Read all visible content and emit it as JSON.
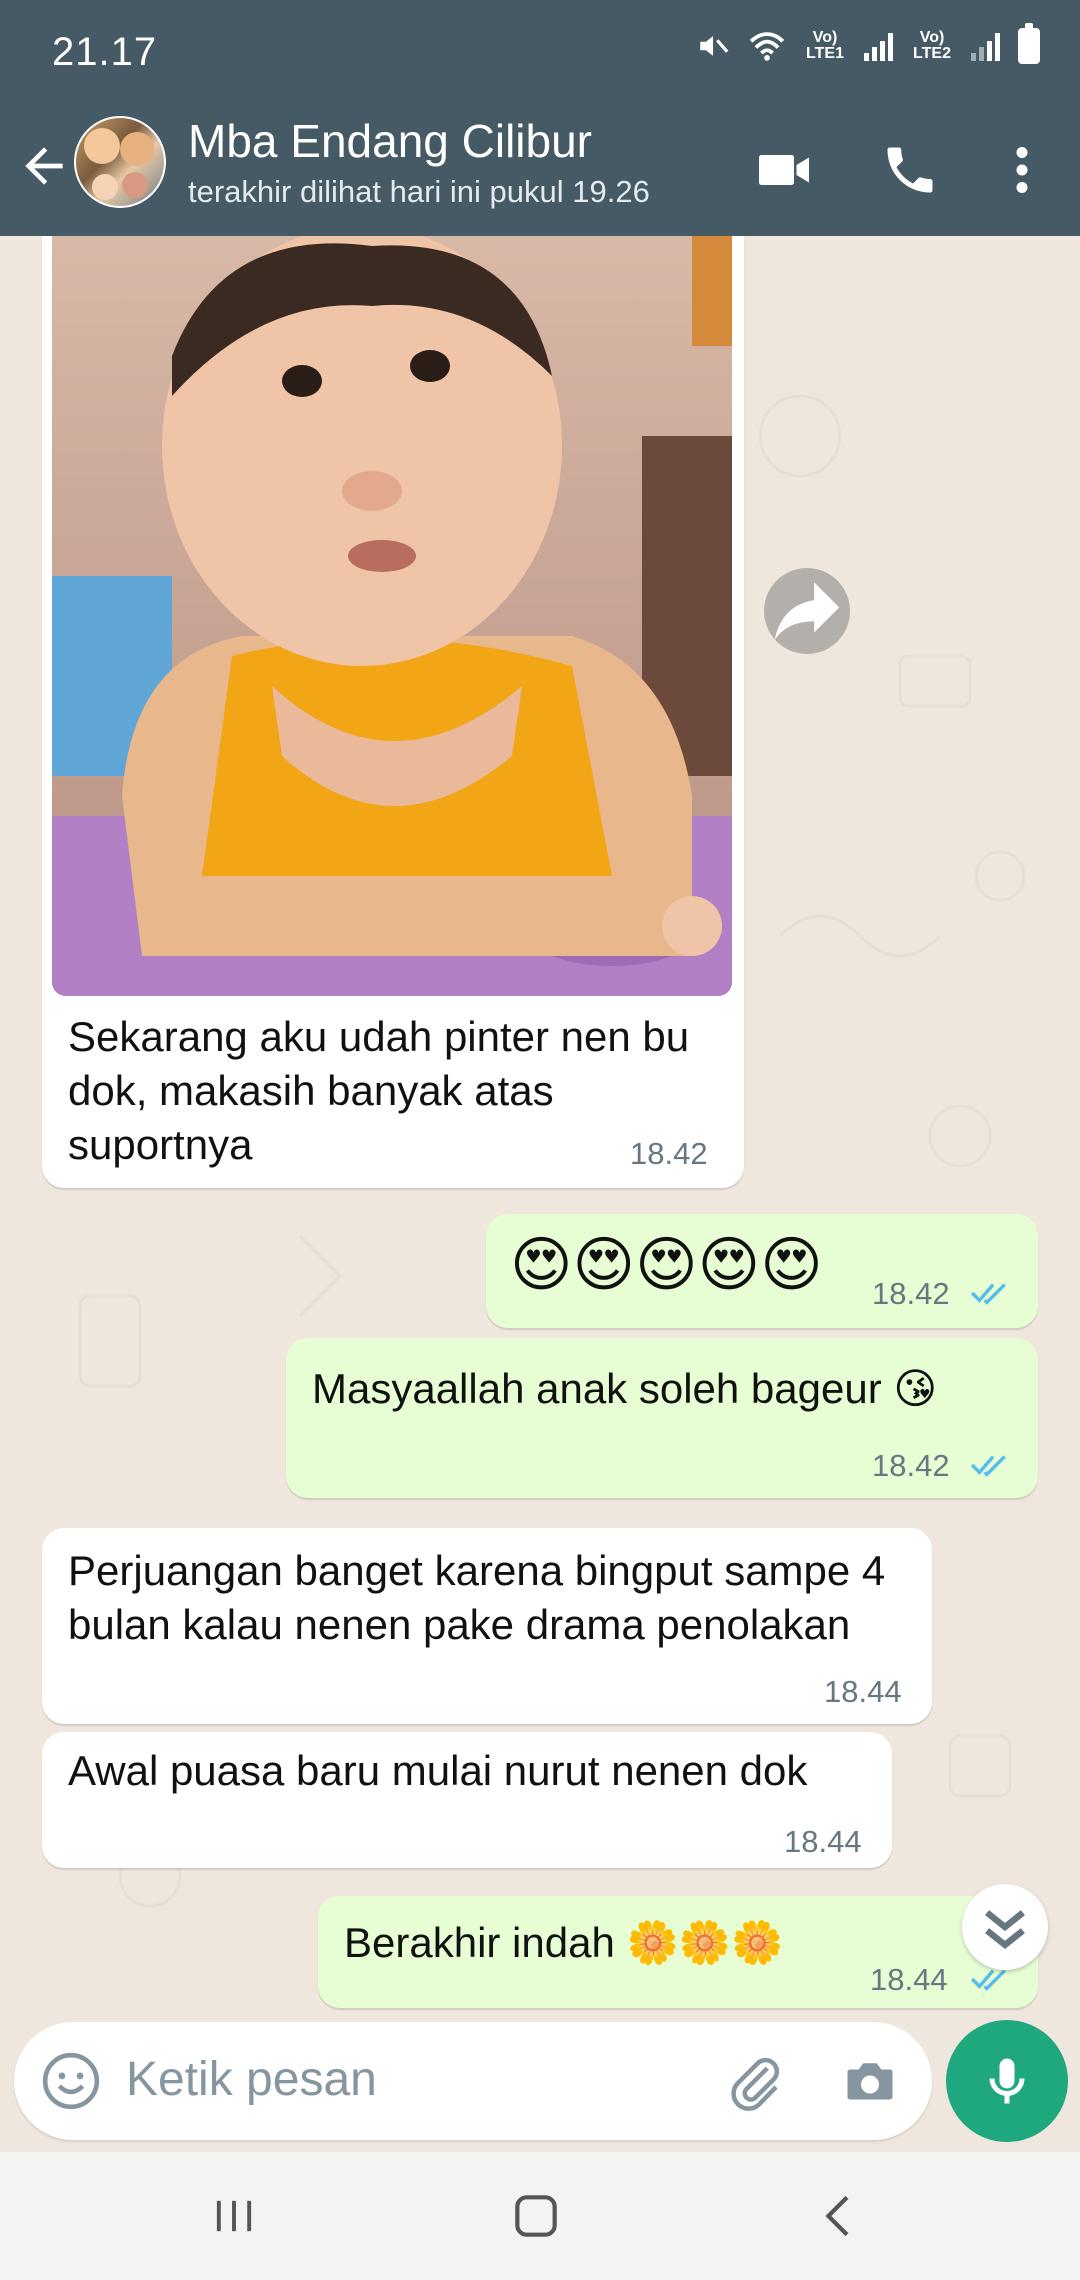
{
  "status_bar": {
    "time": "21.17",
    "sim1": "Vo) LTE1",
    "sim2": "Vo) LTE2",
    "icons": [
      "mute-icon",
      "wifi-icon",
      "signal-icon",
      "battery-icon"
    ]
  },
  "header": {
    "contact_name": "Mba Endang Cilibur",
    "last_seen": "terakhir dilihat hari ini pukul 19.26",
    "icons": [
      "back-arrow-icon",
      "video-call-icon",
      "voice-call-icon",
      "more-options-icon"
    ],
    "background_color": "#455a64"
  },
  "messages": [
    {
      "direction": "incoming",
      "type": "image",
      "image_description": "baby in yellow shirt",
      "text": "Sekarang aku udah pinter nen bu dok, makasih banyak atas suportnya",
      "time": "18.42"
    },
    {
      "direction": "outgoing",
      "text": "😍😍😍😍😍",
      "time": "18.42",
      "status": "read"
    },
    {
      "direction": "outgoing",
      "text": "Masyaallah anak soleh bageur 😘",
      "time": "18.42",
      "status": "read"
    },
    {
      "direction": "incoming",
      "text": "Perjuangan banget karena bingput sampe 4 bulan kalau nenen pake drama penolakan",
      "time": "18.44"
    },
    {
      "direction": "incoming",
      "text": "Awal puasa baru mulai nurut nenen dok",
      "time": "18.44"
    },
    {
      "direction": "outgoing",
      "text": "Berakhir indah 🌼🌼🌼",
      "time": "18.44",
      "status": "read"
    }
  ],
  "input": {
    "placeholder": "Ketik pesan",
    "icons": [
      "emoji-icon",
      "attach-icon",
      "camera-icon",
      "mic-icon"
    ]
  },
  "colors": {
    "incoming_bubble": "#ffffff",
    "outgoing_bubble": "#e7fed4",
    "read_ticks": "#53bdeb",
    "mic_button": "#1fa87e",
    "chat_background": "#efe7de"
  },
  "nav": {
    "icons": [
      "recent-apps-icon",
      "home-icon",
      "back-icon"
    ]
  }
}
